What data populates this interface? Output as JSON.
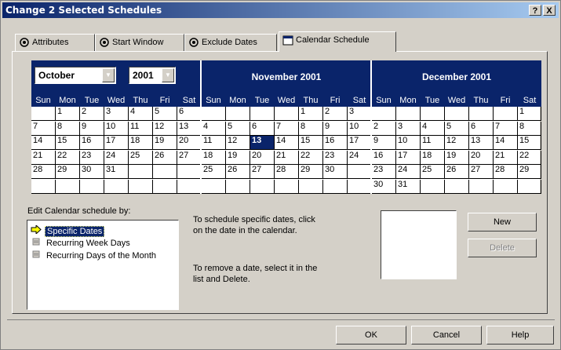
{
  "window": {
    "title": "Change 2 Selected Schedules",
    "help_btn": "?",
    "close_btn": "X"
  },
  "tabs": [
    {
      "label": "Attributes",
      "icon": "gear-icon"
    },
    {
      "label": "Start Window",
      "icon": "gear-icon"
    },
    {
      "label": "Exclude Dates",
      "icon": "gear-icon"
    },
    {
      "label": "Calendar Schedule",
      "icon": "calendar-icon"
    }
  ],
  "calendar": {
    "month_select": "October",
    "year_select": "2001",
    "days_of_week": [
      "Sun",
      "Mon",
      "Tue",
      "Wed",
      "Thu",
      "Fri",
      "Sat"
    ],
    "months": [
      {
        "title": "",
        "rows": [
          [
            "",
            "1",
            "2",
            "3",
            "4",
            "5",
            "6"
          ],
          [
            "7",
            "8",
            "9",
            "10",
            "11",
            "12",
            "13"
          ],
          [
            "14",
            "15",
            "16",
            "17",
            "18",
            "19",
            "20"
          ],
          [
            "21",
            "22",
            "23",
            "24",
            "25",
            "26",
            "27"
          ],
          [
            "28",
            "29",
            "30",
            "31",
            "",
            "",
            ""
          ],
          [
            "",
            "",
            "",
            "",
            "",
            "",
            ""
          ]
        ],
        "selected": []
      },
      {
        "title": "November 2001",
        "rows": [
          [
            "",
            "",
            "",
            "",
            "1",
            "2",
            "3"
          ],
          [
            "4",
            "5",
            "6",
            "7",
            "8",
            "9",
            "10"
          ],
          [
            "11",
            "12",
            "13",
            "14",
            "15",
            "16",
            "17"
          ],
          [
            "18",
            "19",
            "20",
            "21",
            "22",
            "23",
            "24"
          ],
          [
            "25",
            "26",
            "27",
            "28",
            "29",
            "30",
            ""
          ],
          [
            "",
            "",
            "",
            "",
            "",
            "",
            ""
          ]
        ],
        "selected": [
          "13"
        ]
      },
      {
        "title": "December 2001",
        "rows": [
          [
            "",
            "",
            "",
            "",
            "",
            "",
            "1"
          ],
          [
            "2",
            "3",
            "4",
            "5",
            "6",
            "7",
            "8"
          ],
          [
            "9",
            "10",
            "11",
            "12",
            "13",
            "14",
            "15"
          ],
          [
            "16",
            "17",
            "18",
            "19",
            "20",
            "21",
            "22"
          ],
          [
            "23",
            "24",
            "25",
            "26",
            "27",
            "28",
            "29"
          ],
          [
            "30",
            "31",
            "",
            "",
            "",
            "",
            ""
          ]
        ],
        "selected": []
      }
    ]
  },
  "edit": {
    "label": "Edit Calendar schedule by:",
    "options": [
      {
        "label": "Specific Dates",
        "icon": "arrow-right-icon",
        "selected": true
      },
      {
        "label": "Recurring Week Days",
        "icon": "list-icon",
        "selected": false
      },
      {
        "label": "Recurring Days of the Month",
        "icon": "list-icon",
        "selected": false
      }
    ]
  },
  "instructions": {
    "line1": "To schedule specific dates, click",
    "line2": "on the date in the calendar.",
    "line3": "To remove a date, select it in the",
    "line4": "list and Delete."
  },
  "buttons": {
    "new": "New",
    "delete": "Delete",
    "ok": "OK",
    "cancel": "Cancel",
    "help": "Help"
  }
}
